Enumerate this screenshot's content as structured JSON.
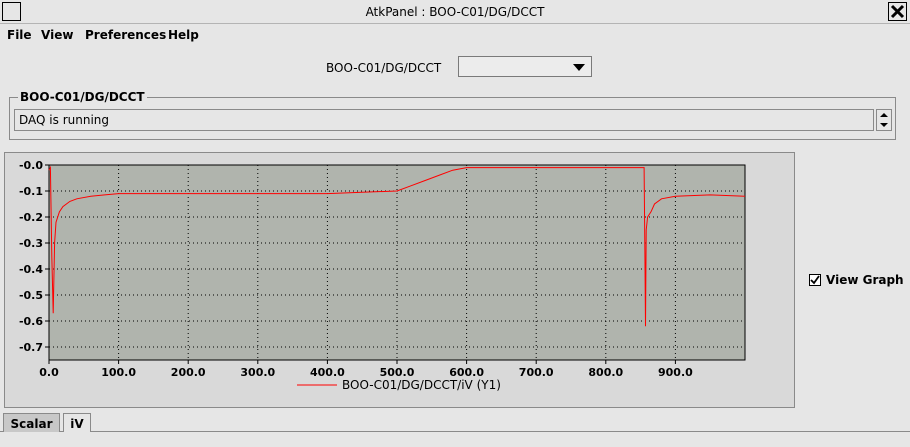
{
  "window": {
    "title": "AtkPanel : BOO-C01/DG/DCCT"
  },
  "menu": [
    "File",
    "View",
    "Preferences",
    "Help"
  ],
  "selector": {
    "label": "BOO-C01/DG/DCCT",
    "value": ""
  },
  "status": {
    "group_title": "BOO-C01/DG/DCCT",
    "text": "DAQ is running"
  },
  "tabs": [
    "Scalar",
    "iV"
  ],
  "view_graph": {
    "label": "View Graph",
    "checked": true
  },
  "colors": {
    "trace": "#ff0000",
    "plot_bg": "#b0b4ad"
  },
  "chart_data": {
    "type": "line",
    "xlim": [
      0,
      1000
    ],
    "ylim": [
      -0.75,
      0.0
    ],
    "x_ticks": [
      "0.0",
      "100.0",
      "200.0",
      "300.0",
      "400.0",
      "500.0",
      "600.0",
      "700.0",
      "800.0",
      "900.0"
    ],
    "y_ticks": [
      "-0.0",
      "-0.1",
      "-0.2",
      "-0.3",
      "-0.4",
      "-0.5",
      "-0.6",
      "-0.7"
    ],
    "grid": true,
    "legend": "bottom",
    "series": [
      {
        "name": "BOO-C01/DG/DCCT/iV (Y1)",
        "color": "#ff0000",
        "x": [
          0,
          2,
          4,
          6,
          8,
          10,
          15,
          20,
          30,
          40,
          60,
          80,
          100,
          150,
          200,
          250,
          300,
          350,
          400,
          450,
          500,
          520,
          540,
          560,
          580,
          600,
          650,
          700,
          750,
          800,
          850,
          855,
          856,
          857,
          858,
          860,
          865,
          870,
          880,
          900,
          950,
          1000
        ],
        "y": [
          -0.02,
          -0.01,
          -0.35,
          -0.57,
          -0.3,
          -0.22,
          -0.18,
          -0.16,
          -0.14,
          -0.13,
          -0.12,
          -0.115,
          -0.11,
          -0.11,
          -0.11,
          -0.11,
          -0.11,
          -0.11,
          -0.11,
          -0.105,
          -0.1,
          -0.08,
          -0.06,
          -0.04,
          -0.02,
          -0.01,
          -0.01,
          -0.01,
          -0.01,
          -0.01,
          -0.01,
          -0.01,
          -0.3,
          -0.62,
          -0.25,
          -0.2,
          -0.18,
          -0.15,
          -0.13,
          -0.12,
          -0.115,
          -0.12
        ]
      }
    ]
  }
}
